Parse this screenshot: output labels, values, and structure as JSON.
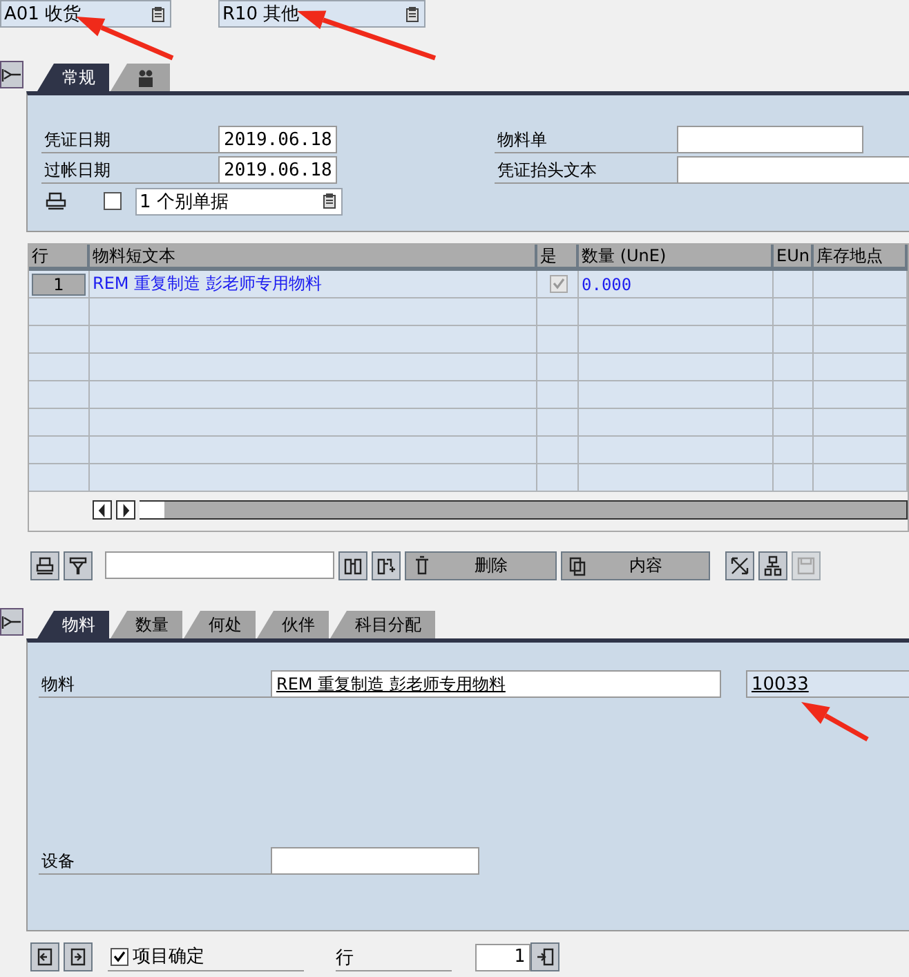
{
  "header_selectors": [
    {
      "value": "A01 收货"
    },
    {
      "value": "R10 其他"
    }
  ],
  "header_tabs": [
    {
      "kind": "text",
      "label": "常规",
      "selected": true
    },
    {
      "kind": "icon",
      "selected": false
    }
  ],
  "header_fields": {
    "doc_date": {
      "label": "凭证日期",
      "value": "2019.06.18"
    },
    "posting_date": {
      "label": "过帐日期",
      "value": "2019.06.18"
    },
    "material_slip": {
      "label": "物料单"
    },
    "header_text": {
      "label": "凭证抬头文本"
    },
    "print_checked": false,
    "print_mode": "1 个别单据"
  },
  "table": {
    "columns": [
      "行",
      "物料短文本",
      "是",
      "数量 (UnE)",
      "EUn",
      "库存地点"
    ],
    "rows": [
      {
        "line": "1",
        "text": "REM 重复制造 彭老师专用物料",
        "checked": true,
        "quantity": "0.000"
      }
    ]
  },
  "toolbar": {
    "delete": "删除",
    "content": "内容"
  },
  "item_tabs": [
    {
      "label": "物料",
      "selected": true
    },
    {
      "label": "数量",
      "selected": false
    },
    {
      "label": "何处",
      "selected": false
    },
    {
      "label": "伙伴",
      "selected": false
    },
    {
      "label": "科目分配",
      "selected": false
    }
  ],
  "item_detail": {
    "material_label": "物料",
    "material_text": "REM 重复制造 彭老师专用物料",
    "material_number": "10033",
    "equipment_label": "设备"
  },
  "footer": {
    "item_ok": {
      "label": "项目确定",
      "checked": true
    },
    "line_label": "行",
    "line_value": "1"
  }
}
